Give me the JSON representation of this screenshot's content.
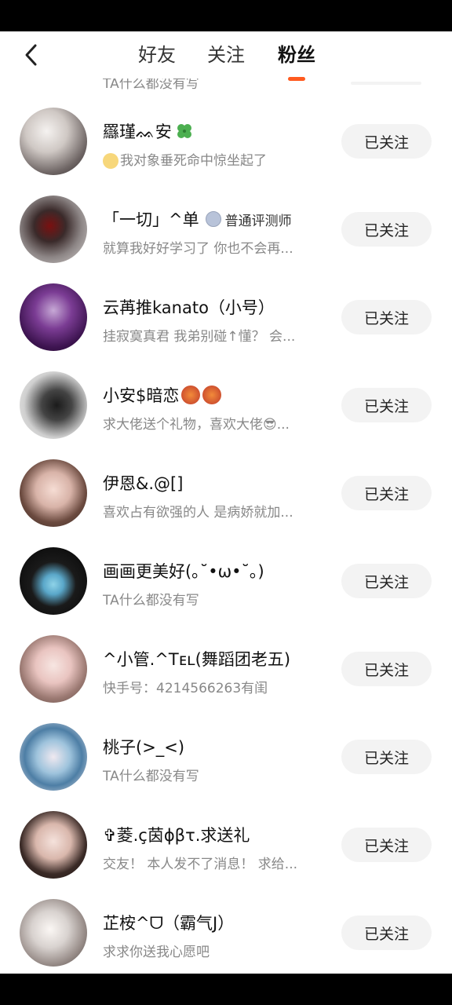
{
  "header": {
    "tabs": [
      "好友",
      "关注",
      "粉丝"
    ],
    "active_tab_index": 2
  },
  "colors": {
    "accent": "#ff5a1f",
    "button_bg": "#f3f3f3",
    "secondary_text": "#888888"
  },
  "partial_top_row": {
    "desc": "TA什么都没有写"
  },
  "follow_label": "已关注",
  "rows": [
    {
      "name": "羉瑾ᨐ安",
      "emoji_after": "four-leaf-clover",
      "desc": "我对象垂死命中惊坐起了",
      "desc_icon": "grimace-emoji"
    },
    {
      "name": "「一切」^单",
      "badge": "普通评测师",
      "desc": "就算我好好学习了 你也不会再..."
    },
    {
      "name": "云苒推kanato（小号）",
      "desc": "挂寂寞真君 我弟别碰↑懂？ 会..."
    },
    {
      "name": "小安$暗恋",
      "emoji_after": "angry-face-x2",
      "desc": "求大佬送个礼物，喜欢大佬😎..."
    },
    {
      "name": "伊恩&.@[]",
      "desc": "喜欢占有欲强的人 是病娇就加..."
    },
    {
      "name": "画画更美好(｡˘•ω•˘｡)",
      "desc": "TA什么都没有写"
    },
    {
      "name": "^小管.^Tᴇʟ(舞蹈团老五)",
      "desc": "快手号：4214566263有闺"
    },
    {
      "name": "桃子(>_<)",
      "desc": "TA什么都没有写"
    },
    {
      "name": "✞菱.ç茵ɸβτ.求送礼",
      "desc": "交友！ 本人发不了消息！ 求给..."
    },
    {
      "name": "芷桉^ᗜ（霸气J）",
      "desc": "求求你送我心愿吧"
    }
  ]
}
